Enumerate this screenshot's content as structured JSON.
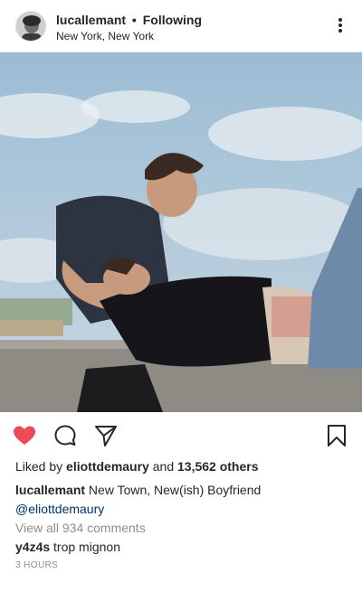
{
  "post": {
    "username": "lucallemant",
    "separator": "•",
    "follow_status": "Following",
    "location": "New York, New York"
  },
  "icons": {
    "more": "more-options-icon",
    "like": "heart-icon",
    "comment": "comment-icon",
    "share": "share-icon",
    "save": "bookmark-icon"
  },
  "colors": {
    "heart": "#ed4956",
    "mention": "#003569",
    "muted": "#8e8e8e"
  },
  "likes": {
    "prefix": "Liked by",
    "liker": "eliottdemaury",
    "conjunction": "and",
    "others": "13,562 others"
  },
  "caption": {
    "user": "lucallemant",
    "text": "New Town, New(ish) Boyfriend",
    "mention": "@eliottdemaury"
  },
  "comments": {
    "view_all": "View all 934 comments",
    "items": [
      {
        "user": "y4z4s",
        "text": "trop mignon"
      }
    ]
  },
  "time": "3 HOURS"
}
